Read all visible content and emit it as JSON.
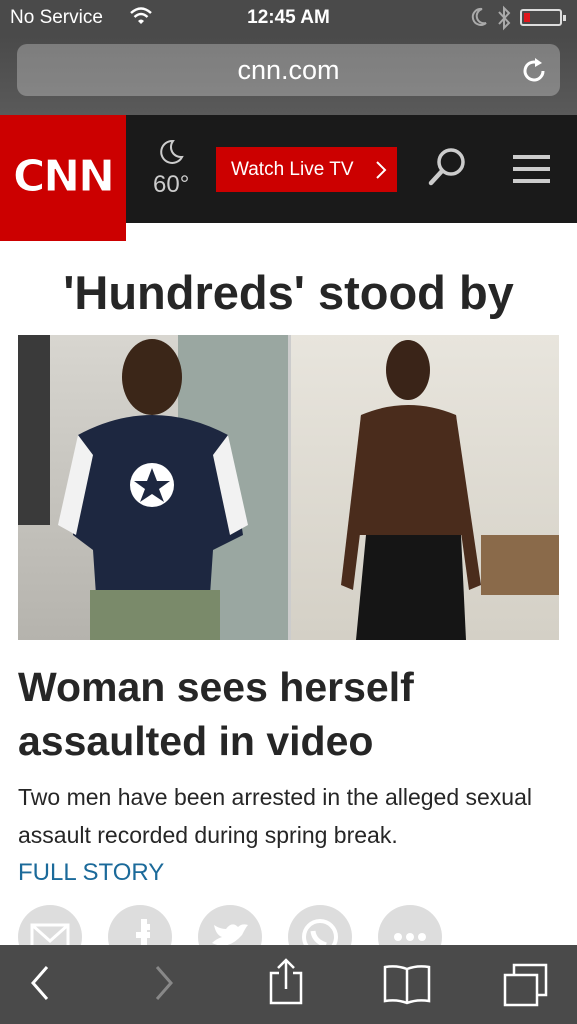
{
  "status_bar": {
    "carrier": "No Service",
    "time": "12:45 AM"
  },
  "browser": {
    "url": "cnn.com"
  },
  "header": {
    "logo_text": "CNN",
    "temperature": "60°",
    "watch_live_label": "Watch Live TV",
    "accent_color": "#cc0000"
  },
  "article": {
    "top_headline": "'Hundreds' stood by",
    "story_title": "Woman sees herself assaulted in video",
    "story_description": "Two men have been arrested in the alleged sexual assault recorded during spring break.",
    "full_story_label": "FULL STORY"
  },
  "share_icons": [
    "email-icon",
    "facebook-icon",
    "twitter-icon",
    "whatsapp-icon",
    "more-icon"
  ],
  "toolbar_icons": [
    "back-icon",
    "forward-icon",
    "share-icon",
    "bookmarks-icon",
    "tabs-icon"
  ]
}
